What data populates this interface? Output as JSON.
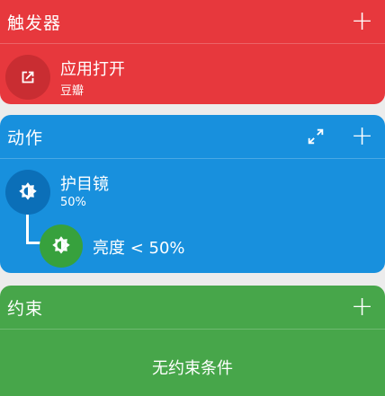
{
  "colors": {
    "trigger": "#e7383d",
    "action": "#1890dd",
    "constraint": "#47a64a",
    "trigger_dark": "#c92d32",
    "action_dark": "#0b6fb8",
    "constraint_green": "#37a13d"
  },
  "trigger": {
    "title": "触发器",
    "add_icon": "plus-icon",
    "item": {
      "icon": "open-in-new-icon",
      "title": "应用打开",
      "subtitle": "豆瓣"
    }
  },
  "action": {
    "title": "动作",
    "expand_icon": "expand-icon",
    "add_icon": "plus-icon",
    "item": {
      "icon": "brightness-icon",
      "title": "护目镜",
      "subtitle": "50%"
    },
    "condition": {
      "icon": "brightness-icon",
      "label": "亮度 < 50%"
    }
  },
  "constraint": {
    "title": "约束",
    "add_icon": "plus-icon",
    "empty": "无约束条件"
  }
}
